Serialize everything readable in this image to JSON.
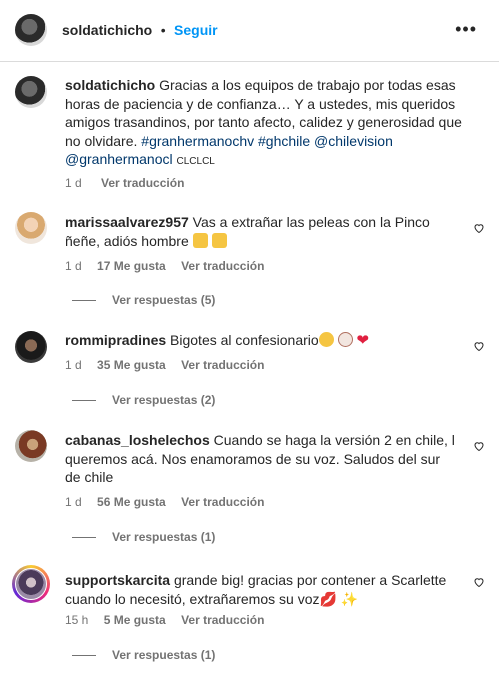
{
  "header": {
    "username": "soldatichicho",
    "separator": "•",
    "follow": "Seguir",
    "more": "•••"
  },
  "caption": {
    "username": "soldatichicho",
    "text": "Gracias a los equipos de trabajo por todas esas horas de paciencia y de confianza… Y a ustedes, mis queridos amigos trasandinos, por tanto afecto, calidez y generosidad que no olvidare.",
    "tags": "#granhermanochv #ghchile @chilevision",
    "tags2": "@granhermanocl",
    "trail": "CLCLCL",
    "time": "1 d",
    "translate": "Ver traducción"
  },
  "comments": [
    {
      "username": "marissaalvarez957",
      "text": "Vas a extrañar las peleas con la Pinco ñeñe, adiós hombre",
      "time": "1 d",
      "likes": "17 Me gusta",
      "translate": "Ver traducción",
      "replies": "Ver respuestas (5)"
    },
    {
      "username": "rommipradines",
      "text": "Bigotes al confesionario",
      "time": "1 d",
      "likes": "35 Me gusta",
      "translate": "Ver traducción",
      "replies": "Ver respuestas (2)"
    },
    {
      "username": "cabanas_loshelechos",
      "text": "Cuando se haga la versión 2 en chile, l queremos acá. Nos enamoramos de su voz. Saludos del sur de chile",
      "time": "1 d",
      "likes": "56 Me gusta",
      "translate": "Ver traducción",
      "replies": "Ver respuestas (1)"
    },
    {
      "username": "supportskarcita",
      "text": "grande big! gracias por contener a Scarlette cuando lo necesitó, extrañaremos su voz",
      "time": "15 h",
      "likes": "5 Me gusta",
      "translate": "Ver traducción",
      "replies": "Ver respuestas (1)"
    }
  ],
  "colors": {
    "link": "#0095f6",
    "tag": "#00376b",
    "muted": "#737373",
    "text": "#262626"
  }
}
